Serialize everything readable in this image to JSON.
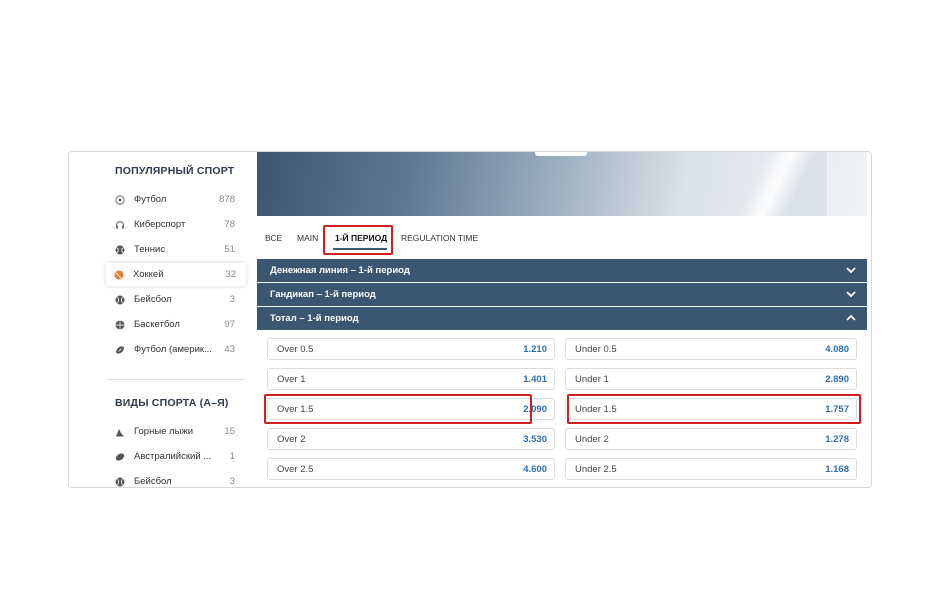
{
  "sidebar": {
    "popular_title": "ПОПУЛЯРНЫЙ СПОРТ",
    "popular": [
      {
        "label": "Футбол",
        "count": "878",
        "icon": "soccer-ball-icon"
      },
      {
        "label": "Киберспорт",
        "count": "78",
        "icon": "headset-icon"
      },
      {
        "label": "Теннис",
        "count": "51",
        "icon": "tennis-ball-icon"
      },
      {
        "label": "Хоккей",
        "count": "32",
        "icon": "hockey-puck-icon",
        "active": true
      },
      {
        "label": "Бейсбол",
        "count": "3",
        "icon": "baseball-icon"
      },
      {
        "label": "Баскетбол",
        "count": "97",
        "icon": "basketball-icon"
      },
      {
        "label": "Футбол (америк...",
        "count": "43",
        "icon": "american-football-icon"
      }
    ],
    "az_title": "ВИДЫ СПОРТА (А–Я)",
    "az": [
      {
        "label": "Горные лыжи",
        "count": "15",
        "icon": "skier-icon"
      },
      {
        "label": "Австралийский ...",
        "count": "1",
        "icon": "aussie-football-icon"
      },
      {
        "label": "Бейсбол",
        "count": "3",
        "icon": "baseball-icon"
      }
    ]
  },
  "tabs": [
    {
      "label": "ВСЕ"
    },
    {
      "label": "MAIN"
    },
    {
      "label": "1-Й ПЕРИОД",
      "active": true
    },
    {
      "label": "REGULATION TIME"
    }
  ],
  "markets": [
    {
      "title": "Денежная линия – 1-й период",
      "expanded": false
    },
    {
      "title": "Гандикап – 1-й период",
      "expanded": false
    },
    {
      "title": "Тотал – 1-й период",
      "expanded": true
    }
  ],
  "odds": [
    {
      "over_label": "Over 0.5",
      "over_value": "1.210",
      "under_label": "Under 0.5",
      "under_value": "4.080"
    },
    {
      "over_label": "Over 1",
      "over_value": "1.401",
      "under_label": "Under 1",
      "under_value": "2.890"
    },
    {
      "over_label": "Over 1.5",
      "over_value": "2.090",
      "under_label": "Under 1.5",
      "under_value": "1.757"
    },
    {
      "over_label": "Over 2",
      "over_value": "3.530",
      "under_label": "Under 2",
      "under_value": "1.278"
    },
    {
      "over_label": "Over 2.5",
      "over_value": "4.600",
      "under_label": "Under 2.5",
      "under_value": "1.168"
    }
  ],
  "colors": {
    "header_bg": "#3b5670",
    "odd_value": "#2f6db5",
    "highlight": "#d01f1f",
    "hockey_icon": "#f07a2a"
  }
}
